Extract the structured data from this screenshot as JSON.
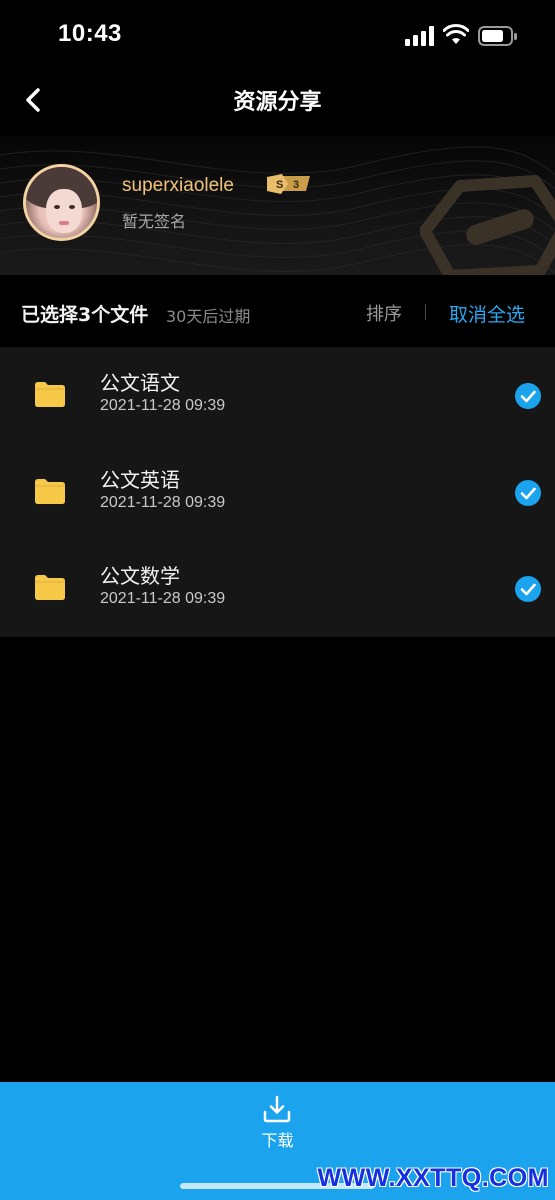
{
  "status_bar": {
    "time": "10:43"
  },
  "nav": {
    "title": "资源分享",
    "back_icon": "chevron-left-icon"
  },
  "profile": {
    "username": "superxiaolele",
    "signature": "暂无签名",
    "level": {
      "letter": "S",
      "number": "3"
    }
  },
  "selection": {
    "count_label": "已选择3个文件",
    "expiry_label": "30天后过期",
    "sort_label": "排序",
    "deselect_all_label": "取消全选"
  },
  "files": [
    {
      "name": "公文语文",
      "date": "2021-11-28 09:39",
      "selected": true
    },
    {
      "name": "公文英语",
      "date": "2021-11-28 09:39",
      "selected": true
    },
    {
      "name": "公文数学",
      "date": "2021-11-28 09:39",
      "selected": true
    }
  ],
  "download": {
    "label": "下载"
  },
  "watermark": "WWW.XXTTQ.COM",
  "colors": {
    "accent": "#1ba3ee",
    "link": "#2aa7ef",
    "username": "#f0c27b",
    "folder": "#f7c948",
    "row_background": "#161616"
  }
}
